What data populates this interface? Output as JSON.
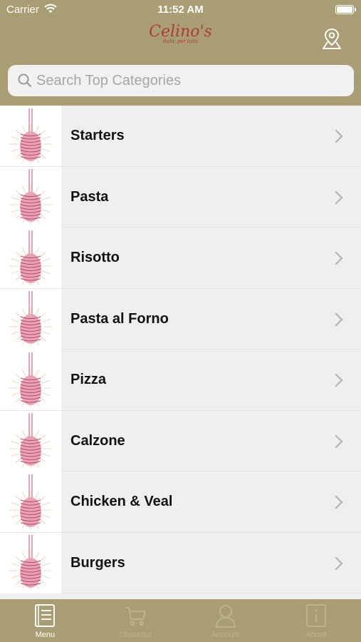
{
  "status_bar": {
    "carrier": "Carrier",
    "time": "11:52 AM"
  },
  "header": {
    "logo_name": "Celino's",
    "logo_tagline": "italic per tutti",
    "location_icon": "location-pin-icon"
  },
  "search": {
    "placeholder": "Search Top Categories",
    "value": ""
  },
  "categories": [
    {
      "label": "Starters"
    },
    {
      "label": "Pasta"
    },
    {
      "label": "Risotto"
    },
    {
      "label": "Pasta al Forno"
    },
    {
      "label": "Pizza"
    },
    {
      "label": "Calzone"
    },
    {
      "label": "Chicken & Veal"
    },
    {
      "label": "Burgers"
    }
  ],
  "tabbar": {
    "tabs": [
      {
        "label": "Menu",
        "icon": "menu-book-icon",
        "active": true
      },
      {
        "label": "Checkout",
        "icon": "cart-icon",
        "active": false
      },
      {
        "label": "Account",
        "icon": "user-icon",
        "active": false
      },
      {
        "label": "About",
        "icon": "info-icon",
        "active": false
      }
    ]
  },
  "colors": {
    "brand": "#a89d73",
    "logo": "#b23a3a",
    "row_bg": "#efefef"
  }
}
